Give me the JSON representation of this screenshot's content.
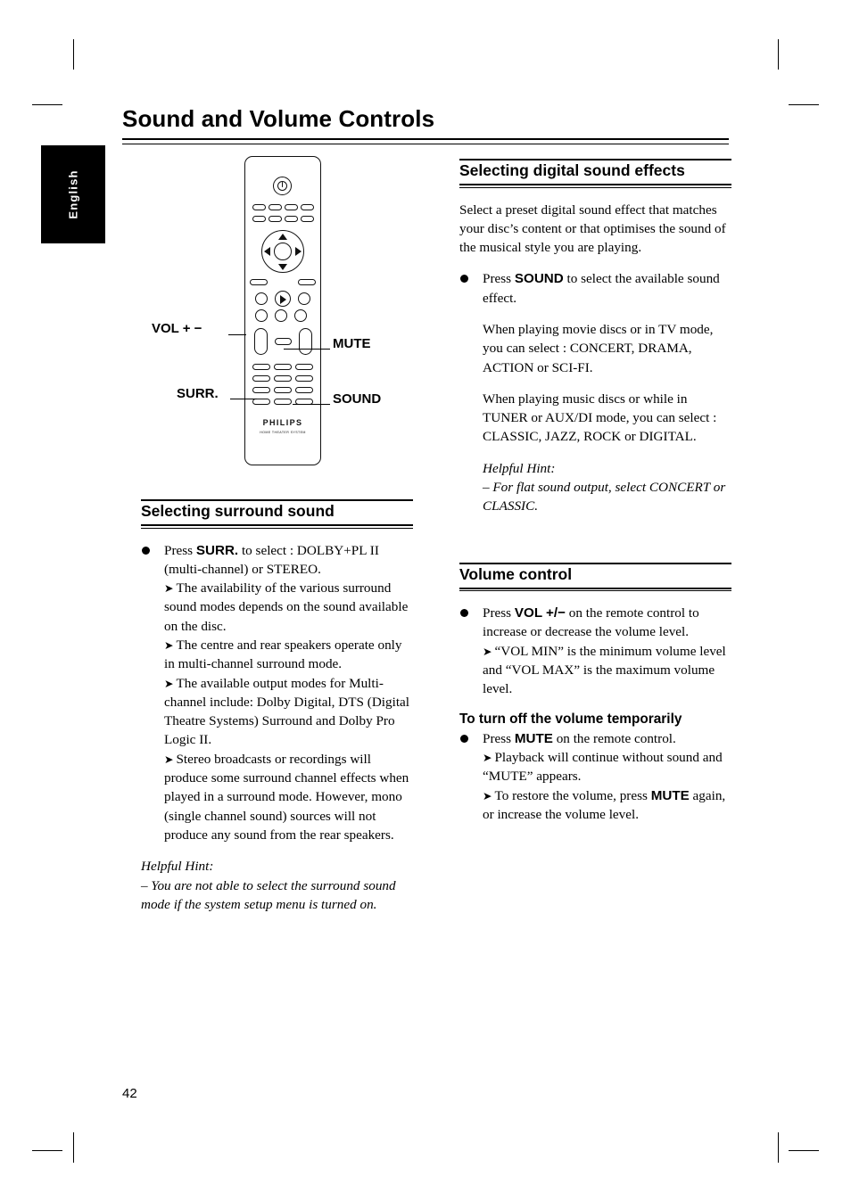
{
  "page": {
    "title": "Sound and Volume Controls",
    "language_tab": "English",
    "page_number": "42"
  },
  "figure": {
    "name": "remote-control-diagram",
    "brand": "PHILIPS",
    "brand_sub": "HOME THEATER SYSTEM",
    "callouts": {
      "vol": "VOL + −",
      "surr": "SURR.",
      "mute": "MUTE",
      "sound": "SOUND"
    }
  },
  "left_column": {
    "section": {
      "heading": "Selecting surround sound",
      "bullet": {
        "lead_1": "Press ",
        "bold_1": "SURR.",
        "lead_2": " to select : DOLBY+PL II (multi-channel) or STEREO.",
        "arrows": [
          "The availability of the various surround sound modes depends on the sound available on the disc.",
          "The centre and rear speakers operate only in multi-channel surround mode.",
          "The available output modes for Multi-channel include: Dolby Digital, DTS (Digital Theatre Systems) Surround and Dolby Pro Logic II.",
          "Stereo broadcasts or recordings will produce some surround channel effects when played in a surround mode. However, mono (single channel sound) sources will not produce any sound from the rear speakers."
        ]
      },
      "hint_title": "Helpful Hint:",
      "hint_text": "–  You are not able to select the surround sound mode if the system setup menu is turned on."
    }
  },
  "right_column": {
    "section_digital": {
      "heading": "Selecting digital sound effects",
      "intro": "Select a preset digital sound effect that matches your disc’s content or that optimises the sound of the musical style you are playing.",
      "bullet": {
        "lead_1": "Press ",
        "bold_1": "SOUND",
        "lead_2": " to select the available sound effect."
      },
      "para_movie": "When playing movie discs or in TV mode, you can select : CONCERT, DRAMA, ACTION or SCI-FI.",
      "para_music": "When playing music discs or while in TUNER or AUX/DI mode, you can select : CLASSIC, JAZZ, ROCK or DIGITAL.",
      "hint_title": "Helpful Hint:",
      "hint_text": "–  For flat sound output, select CONCERT or CLASSIC."
    },
    "section_volume": {
      "heading": "Volume control",
      "bullet": {
        "lead_1": "Press ",
        "bold_1": "VOL  +/−",
        "lead_2": " on the remote control to increase or decrease the volume level.",
        "arrow_1": "“VOL MIN” is the minimum volume level and “VOL MAX” is the maximum volume level."
      },
      "subhead": "To turn off the volume temporarily",
      "bullet2": {
        "lead_1": "Press ",
        "bold_1": "MUTE",
        "lead_2": " on the remote control.",
        "arrow_1": "Playback will continue without sound and “MUTE” appears.",
        "arrow_2a": "To restore the volume, press ",
        "arrow_2b": "MUTE",
        "arrow_2c": " again, or increase the volume level."
      }
    }
  }
}
